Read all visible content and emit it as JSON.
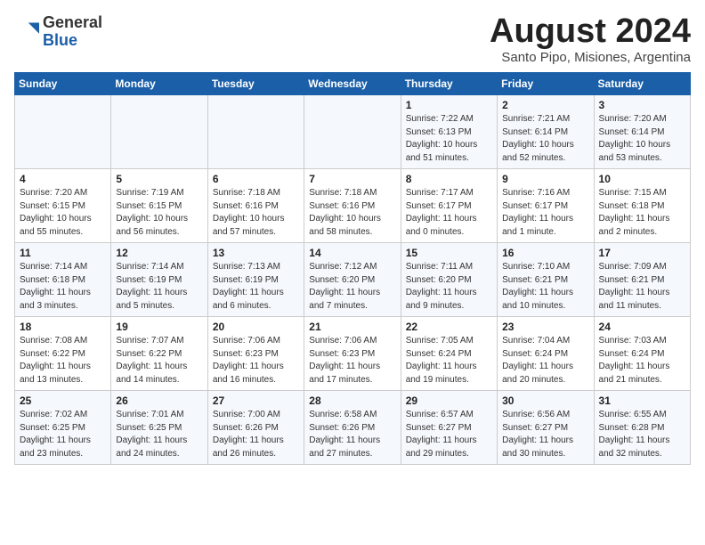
{
  "logo": {
    "general": "General",
    "blue": "Blue"
  },
  "header": {
    "title": "August 2024",
    "subtitle": "Santo Pipo, Misiones, Argentina"
  },
  "weekdays": [
    "Sunday",
    "Monday",
    "Tuesday",
    "Wednesday",
    "Thursday",
    "Friday",
    "Saturday"
  ],
  "weeks": [
    [
      {
        "day": "",
        "info": ""
      },
      {
        "day": "",
        "info": ""
      },
      {
        "day": "",
        "info": ""
      },
      {
        "day": "",
        "info": ""
      },
      {
        "day": "1",
        "info": "Sunrise: 7:22 AM\nSunset: 6:13 PM\nDaylight: 10 hours\nand 51 minutes."
      },
      {
        "day": "2",
        "info": "Sunrise: 7:21 AM\nSunset: 6:14 PM\nDaylight: 10 hours\nand 52 minutes."
      },
      {
        "day": "3",
        "info": "Sunrise: 7:20 AM\nSunset: 6:14 PM\nDaylight: 10 hours\nand 53 minutes."
      }
    ],
    [
      {
        "day": "4",
        "info": "Sunrise: 7:20 AM\nSunset: 6:15 PM\nDaylight: 10 hours\nand 55 minutes."
      },
      {
        "day": "5",
        "info": "Sunrise: 7:19 AM\nSunset: 6:15 PM\nDaylight: 10 hours\nand 56 minutes."
      },
      {
        "day": "6",
        "info": "Sunrise: 7:18 AM\nSunset: 6:16 PM\nDaylight: 10 hours\nand 57 minutes."
      },
      {
        "day": "7",
        "info": "Sunrise: 7:18 AM\nSunset: 6:16 PM\nDaylight: 10 hours\nand 58 minutes."
      },
      {
        "day": "8",
        "info": "Sunrise: 7:17 AM\nSunset: 6:17 PM\nDaylight: 11 hours\nand 0 minutes."
      },
      {
        "day": "9",
        "info": "Sunrise: 7:16 AM\nSunset: 6:17 PM\nDaylight: 11 hours\nand 1 minute."
      },
      {
        "day": "10",
        "info": "Sunrise: 7:15 AM\nSunset: 6:18 PM\nDaylight: 11 hours\nand 2 minutes."
      }
    ],
    [
      {
        "day": "11",
        "info": "Sunrise: 7:14 AM\nSunset: 6:18 PM\nDaylight: 11 hours\nand 3 minutes."
      },
      {
        "day": "12",
        "info": "Sunrise: 7:14 AM\nSunset: 6:19 PM\nDaylight: 11 hours\nand 5 minutes."
      },
      {
        "day": "13",
        "info": "Sunrise: 7:13 AM\nSunset: 6:19 PM\nDaylight: 11 hours\nand 6 minutes."
      },
      {
        "day": "14",
        "info": "Sunrise: 7:12 AM\nSunset: 6:20 PM\nDaylight: 11 hours\nand 7 minutes."
      },
      {
        "day": "15",
        "info": "Sunrise: 7:11 AM\nSunset: 6:20 PM\nDaylight: 11 hours\nand 9 minutes."
      },
      {
        "day": "16",
        "info": "Sunrise: 7:10 AM\nSunset: 6:21 PM\nDaylight: 11 hours\nand 10 minutes."
      },
      {
        "day": "17",
        "info": "Sunrise: 7:09 AM\nSunset: 6:21 PM\nDaylight: 11 hours\nand 11 minutes."
      }
    ],
    [
      {
        "day": "18",
        "info": "Sunrise: 7:08 AM\nSunset: 6:22 PM\nDaylight: 11 hours\nand 13 minutes."
      },
      {
        "day": "19",
        "info": "Sunrise: 7:07 AM\nSunset: 6:22 PM\nDaylight: 11 hours\nand 14 minutes."
      },
      {
        "day": "20",
        "info": "Sunrise: 7:06 AM\nSunset: 6:23 PM\nDaylight: 11 hours\nand 16 minutes."
      },
      {
        "day": "21",
        "info": "Sunrise: 7:06 AM\nSunset: 6:23 PM\nDaylight: 11 hours\nand 17 minutes."
      },
      {
        "day": "22",
        "info": "Sunrise: 7:05 AM\nSunset: 6:24 PM\nDaylight: 11 hours\nand 19 minutes."
      },
      {
        "day": "23",
        "info": "Sunrise: 7:04 AM\nSunset: 6:24 PM\nDaylight: 11 hours\nand 20 minutes."
      },
      {
        "day": "24",
        "info": "Sunrise: 7:03 AM\nSunset: 6:24 PM\nDaylight: 11 hours\nand 21 minutes."
      }
    ],
    [
      {
        "day": "25",
        "info": "Sunrise: 7:02 AM\nSunset: 6:25 PM\nDaylight: 11 hours\nand 23 minutes."
      },
      {
        "day": "26",
        "info": "Sunrise: 7:01 AM\nSunset: 6:25 PM\nDaylight: 11 hours\nand 24 minutes."
      },
      {
        "day": "27",
        "info": "Sunrise: 7:00 AM\nSunset: 6:26 PM\nDaylight: 11 hours\nand 26 minutes."
      },
      {
        "day": "28",
        "info": "Sunrise: 6:58 AM\nSunset: 6:26 PM\nDaylight: 11 hours\nand 27 minutes."
      },
      {
        "day": "29",
        "info": "Sunrise: 6:57 AM\nSunset: 6:27 PM\nDaylight: 11 hours\nand 29 minutes."
      },
      {
        "day": "30",
        "info": "Sunrise: 6:56 AM\nSunset: 6:27 PM\nDaylight: 11 hours\nand 30 minutes."
      },
      {
        "day": "31",
        "info": "Sunrise: 6:55 AM\nSunset: 6:28 PM\nDaylight: 11 hours\nand 32 minutes."
      }
    ]
  ]
}
